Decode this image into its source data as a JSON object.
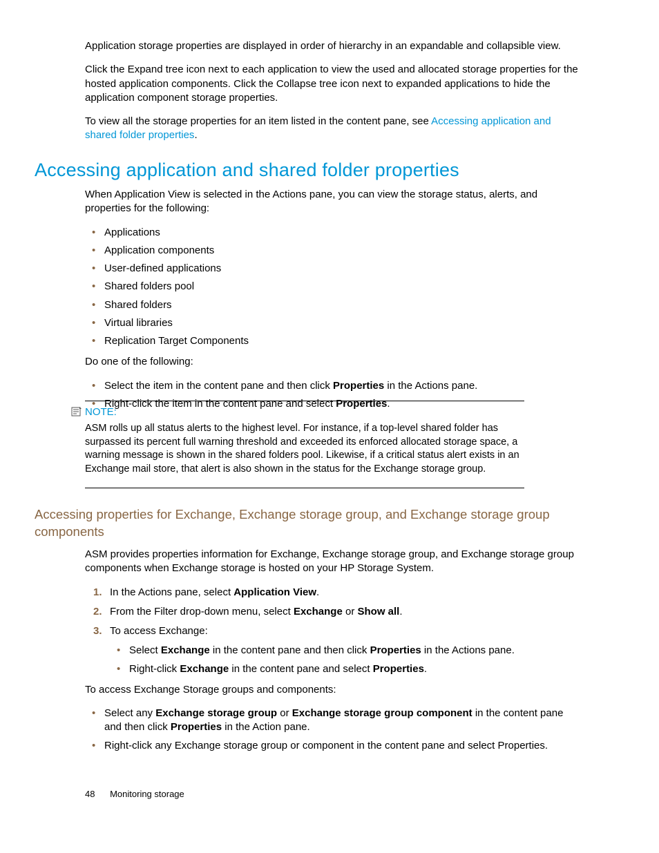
{
  "intro": {
    "p1": "Application storage properties are displayed in order of hierarchy in an expandable and collapsible view.",
    "p2": "Click the Expand tree icon next to each application to view the used and allocated storage properties for the hosted application components. Click the Collapse tree icon next to expanded applications to hide the application component storage properties.",
    "p3_a": "To view all the storage properties for an item listed in the content pane, see ",
    "p3_link": "Accessing application and shared folder properties",
    "p3_b": "."
  },
  "sec1": {
    "heading": "Accessing application and shared folder properties",
    "lead": "When Application View is selected in the Actions pane, you can view the storage status, alerts, and properties for the following:",
    "items": [
      "Applications",
      "Application components",
      "User-defined applications",
      "Shared folders pool",
      "Shared folders",
      "Virtual libraries",
      "Replication Target Components"
    ],
    "do_one": "Do one of the following:",
    "actions": {
      "a1_a": "Select the item in the content pane and then click ",
      "a1_bold": "Properties",
      "a1_b": " in the Actions pane.",
      "a2_a": "Right-click the item in the content pane and select ",
      "a2_bold": "Properties",
      "a2_b": "."
    }
  },
  "note": {
    "label": "NOTE:",
    "text": "ASM rolls up all status alerts to the highest level. For instance, if a top-level shared folder has surpassed its percent full warning threshold and exceeded its enforced allocated storage space, a warning message is shown in the shared folders pool. Likewise, if a critical status alert exists in an Exchange mail store, that alert is also shown in the status for the Exchange storage group."
  },
  "sec2": {
    "heading": "Accessing properties for Exchange, Exchange storage group, and Exchange storage group components",
    "lead": "ASM provides properties information for Exchange, Exchange storage group, and Exchange storage group components when Exchange storage is hosted on your HP Storage System.",
    "step1_a": "In the Actions pane, select ",
    "step1_bold": "Application View",
    "step1_b": ".",
    "step2_a": "From the Filter drop-down menu, select ",
    "step2_bold1": "Exchange",
    "step2_mid": " or ",
    "step2_bold2": "Show all",
    "step2_b": ".",
    "step3": "To access Exchange:",
    "step3_sub1_a": "Select ",
    "step3_sub1_bold1": "Exchange",
    "step3_sub1_mid": " in the content pane and then click ",
    "step3_sub1_bold2": "Properties",
    "step3_sub1_b": " in the Actions pane.",
    "step3_sub2_a": "Right-click ",
    "step3_sub2_bold": "Exchange",
    "step3_sub2_mid": " in the content pane and select ",
    "step3_sub2_bold2": "Properties",
    "step3_sub2_b": ".",
    "after": "To access Exchange Storage groups and components:",
    "after_b1_a": "Select any ",
    "after_b1_bold1": "Exchange storage group",
    "after_b1_mid": " or ",
    "after_b1_bold2": "Exchange storage group component",
    "after_b1_c": " in the content pane and then click ",
    "after_b1_bold3": "Properties",
    "after_b1_d": " in the Action pane.",
    "after_b2": "Right-click any Exchange storage group or component in the content pane and select Properties."
  },
  "footer": {
    "page": "48",
    "title": "Monitoring storage"
  }
}
